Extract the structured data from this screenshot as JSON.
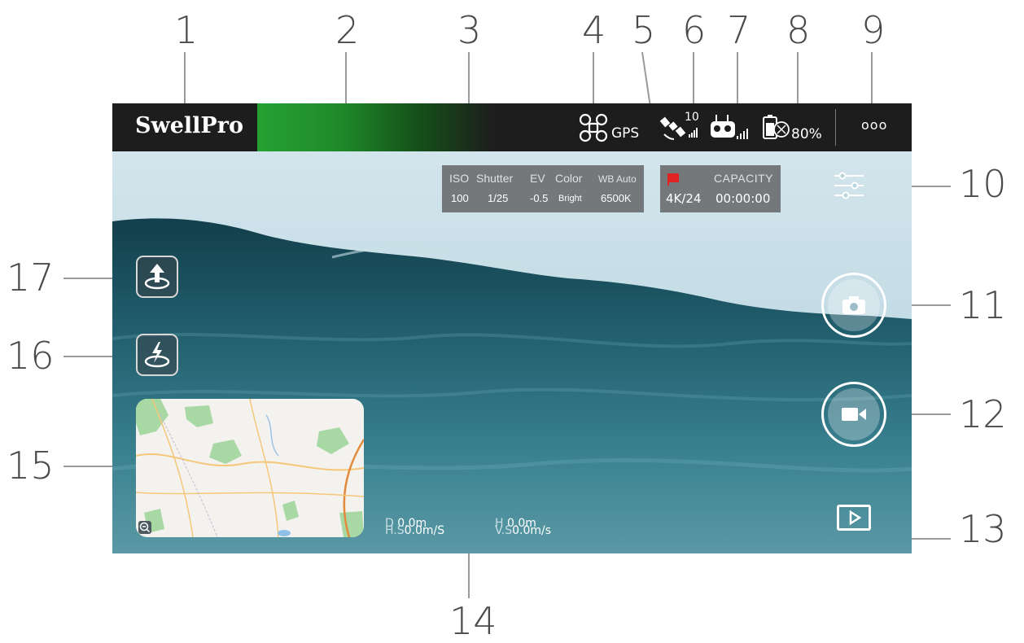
{
  "callouts": {
    "n1": "1",
    "n2": "2",
    "n3": "3",
    "n4": "4",
    "n5": "5",
    "n6": "6",
    "n7": "7",
    "n8": "8",
    "n9": "9",
    "n10": "10",
    "n11": "11",
    "n12": "12",
    "n13": "13",
    "n14": "14",
    "n15": "15",
    "n16": "16",
    "n17": "17"
  },
  "topbar": {
    "logo": "SwellPro",
    "gps_label": "GPS",
    "satellite_count": "10",
    "battery_percent": "80%",
    "more_label": "ooo",
    "signal_color": "#26a132"
  },
  "camera_settings": {
    "headers": {
      "iso": "ISO",
      "shutter": "Shutter",
      "ev": "EV",
      "color": "Color",
      "wb": "WB Auto"
    },
    "values": {
      "iso": "100",
      "shutter": "1/25",
      "ev": "-0.5",
      "color": "Bright",
      "wb": "6500K"
    }
  },
  "recording": {
    "capacity_label": "CAPACITY",
    "resolution": "4K/24",
    "time": "00:00:00",
    "flag_color": "#e02424"
  },
  "telemetry": {
    "d_label": "D",
    "d_value": "0.0m",
    "h_label": "H",
    "h_value": "0.0m",
    "hs_label": "H.S",
    "hs_value": "0.0m/S",
    "vs_label": "V.S",
    "vs_value": "0.0m/s"
  },
  "icons": {
    "settings": "sliders-icon",
    "photo": "camera-icon",
    "video": "video-camera-icon",
    "playback": "play-icon",
    "takeoff": "takeoff-icon",
    "return_home": "return-home-icon",
    "map_zoom": "zoom-out-icon"
  }
}
